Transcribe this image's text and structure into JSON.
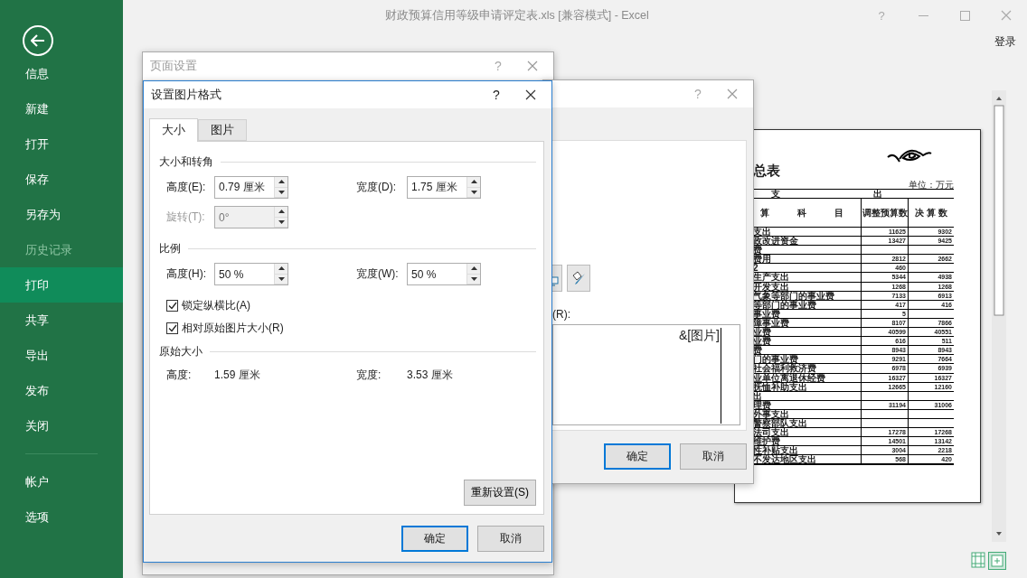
{
  "window": {
    "title": "财政预算信用等级申请评定表.xls  [兼容模式] - Excel",
    "help": "?",
    "signin": "登录"
  },
  "backstage": {
    "items": [
      {
        "label": "信息",
        "selected": false,
        "disabled": false
      },
      {
        "label": "新建",
        "selected": false,
        "disabled": false
      },
      {
        "label": "打开",
        "selected": false,
        "disabled": false
      },
      {
        "label": "保存",
        "selected": false,
        "disabled": false
      },
      {
        "label": "另存为",
        "selected": false,
        "disabled": false
      },
      {
        "label": "历史记录",
        "selected": false,
        "disabled": true
      },
      {
        "label": "打印",
        "selected": true,
        "disabled": false
      },
      {
        "label": "共享",
        "selected": false,
        "disabled": false
      },
      {
        "label": "导出",
        "selected": false,
        "disabled": false
      },
      {
        "label": "发布",
        "selected": false,
        "disabled": false
      },
      {
        "label": "关闭",
        "selected": false,
        "disabled": false
      }
    ],
    "footer_items": [
      {
        "label": "帐户",
        "selected": false,
        "disabled": false
      },
      {
        "label": "选项",
        "selected": false,
        "disabled": false
      }
    ]
  },
  "preview": {
    "title": "总表",
    "unit": "单位：万元",
    "group_headers": [
      "支",
      "出"
    ],
    "columns": [
      "算 科 目",
      "调整预算数",
      "决 算 数"
    ],
    "rows": [
      {
        "item": "支出",
        "budget": "11625",
        "final": "9302"
      },
      {
        "item": "政改进资金",
        "budget": "13427",
        "final": "9425"
      },
      {
        "item": "费",
        "budget": "",
        "final": ""
      },
      {
        "item": "费用",
        "budget": "2812",
        "final": "2662"
      },
      {
        "item": "2",
        "budget": "460",
        "final": ""
      },
      {
        "item": "生产支出",
        "budget": "5344",
        "final": "4938"
      },
      {
        "item": "开发支出",
        "budget": "1268",
        "final": "1268"
      },
      {
        "item": "气象等部门的事业费",
        "budget": "7133",
        "final": "6913"
      },
      {
        "item": "等部门的事业费",
        "budget": "417",
        "final": "416"
      },
      {
        "item": "事业费",
        "budget": "5",
        "final": ""
      },
      {
        "item": "障事业费",
        "budget": "8107",
        "final": "7866"
      },
      {
        "item": "业费",
        "budget": "40599",
        "final": "40551"
      },
      {
        "item": "业费",
        "budget": "616",
        "final": "511"
      },
      {
        "item": "费",
        "budget": "8943",
        "final": "8943"
      },
      {
        "item": "门的事业费",
        "budget": "9291",
        "final": "7664"
      },
      {
        "item": "社会福利救济费",
        "budget": "6978",
        "final": "6939"
      },
      {
        "item": "业单位离退休经费",
        "budget": "16327",
        "final": "16327"
      },
      {
        "item": "抚恤补助支出",
        "budget": "12665",
        "final": "12160"
      },
      {
        "item": "出",
        "budget": "",
        "final": ""
      },
      {
        "item": "理费",
        "budget": "31194",
        "final": "31006"
      },
      {
        "item": "外事支出",
        "budget": "",
        "final": ""
      },
      {
        "item": "警察部队支出",
        "budget": "",
        "final": ""
      },
      {
        "item": "法司支出",
        "budget": "17278",
        "final": "17268"
      },
      {
        "item": "维护费",
        "budget": "14501",
        "final": "13142"
      },
      {
        "item": "性补贴支出",
        "budget": "3004",
        "final": "2218"
      },
      {
        "item": "不发达地区支出",
        "budget": "568",
        "final": "420"
      }
    ]
  },
  "page_setup_dialog": {
    "title": "页面设置",
    "help": "?"
  },
  "footer_dialog": {
    "help": "?",
    "right_label": "(R):",
    "right_text": "&[图片]",
    "buttons": [
      {
        "label": "确定",
        "default": true
      },
      {
        "label": "取消",
        "default": false
      }
    ]
  },
  "format_dialog": {
    "title": "设置图片格式",
    "help": "?",
    "tabs": [
      {
        "label": "大小",
        "selected": true
      },
      {
        "label": "图片",
        "selected": false
      }
    ],
    "size_section": "大小和转角",
    "size_fields": [
      {
        "label": "高度(E):",
        "value": "0.79 厘米",
        "disabled": false
      },
      {
        "label": "宽度(D):",
        "value": "1.75 厘米",
        "disabled": false
      },
      {
        "label": "旋转(T):",
        "value": "0°",
        "disabled": true
      }
    ],
    "scale_section": "比例",
    "scale_fields": [
      {
        "label": "高度(H):",
        "value": "50 %",
        "disabled": false
      },
      {
        "label": "宽度(W):",
        "value": "50 %",
        "disabled": false
      }
    ],
    "checkboxes": [
      {
        "label": "锁定纵横比(A)",
        "checked": true
      },
      {
        "label": "相对原始图片大小(R)",
        "checked": true
      }
    ],
    "original_section": "原始大小",
    "original": [
      {
        "label": "高度:",
        "value": "1.59 厘米"
      },
      {
        "label": "宽度:",
        "value": "3.53 厘米"
      }
    ],
    "reset_button": "重新设置(S)",
    "buttons": [
      {
        "label": "确定",
        "default": true
      },
      {
        "label": "取消",
        "default": false
      }
    ]
  }
}
